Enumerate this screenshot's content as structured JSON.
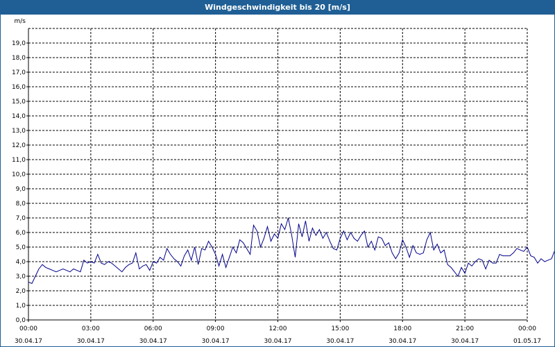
{
  "window": {
    "title": "Windgeschwindigkeit bis 20 [m/s]"
  },
  "colors": {
    "titlebar": "#1f5f95",
    "series": "#00008b",
    "grid": "#000000"
  },
  "chart_data": {
    "type": "line",
    "title": "Windgeschwindigkeit bis 20 [m/s]",
    "ylabel": "m/s",
    "ylim": [
      0,
      20
    ],
    "y_ticks": [
      "0,0",
      "1,0",
      "2,0",
      "3,0",
      "4,0",
      "5,0",
      "6,0",
      "7,0",
      "8,0",
      "9,0",
      "10,0",
      "11,0",
      "12,0",
      "13,0",
      "14,0",
      "15,0",
      "16,0",
      "17,0",
      "18,0",
      "19,0"
    ],
    "x_ticks": [
      {
        "time": "00:00",
        "date": "30.04.17"
      },
      {
        "time": "03:00",
        "date": "30.04.17"
      },
      {
        "time": "06:00",
        "date": "30.04.17"
      },
      {
        "time": "09:00",
        "date": "30.04.17"
      },
      {
        "time": "12:00",
        "date": "30.04.17"
      },
      {
        "time": "15:00",
        "date": "30.04.17"
      },
      {
        "time": "18:00",
        "date": "30.04.17"
      },
      {
        "time": "21:00",
        "date": "30.04.17"
      },
      {
        "time": "00:00",
        "date": "01.05.17"
      }
    ],
    "xlim": [
      "30.04.17 00:00",
      "01.05.17 00:00"
    ],
    "grid": true,
    "sample_interval_minutes": 10,
    "series": [
      {
        "values": [
          2.6,
          2.5,
          3.0,
          3.5,
          3.8,
          3.6,
          3.5,
          3.4,
          3.3,
          3.4,
          3.5,
          3.4,
          3.3,
          3.5,
          3.4,
          3.3,
          4.1,
          3.9,
          4.0,
          3.9,
          4.5,
          3.9,
          3.8,
          4.0,
          3.9,
          3.7,
          3.5,
          3.3,
          3.6,
          3.8,
          3.9,
          4.6,
          3.5,
          3.7,
          3.8,
          3.4,
          4.0,
          3.9,
          4.3,
          4.1,
          4.9,
          4.5,
          4.2,
          4.0,
          3.7,
          4.4,
          4.8,
          4.1,
          5.0,
          3.8,
          4.9,
          4.8,
          5.4,
          5.0,
          4.5,
          3.7,
          4.5,
          3.6,
          4.3,
          5.0,
          4.6,
          5.5,
          5.3,
          4.9,
          4.5,
          6.5,
          6.1,
          5.0,
          5.6,
          6.4,
          5.4,
          5.9,
          5.6,
          6.6,
          6.2,
          7.0,
          5.8,
          4.3,
          6.6,
          5.7,
          6.8,
          5.4,
          6.3,
          5.8,
          6.2,
          5.6,
          6.0,
          5.4,
          4.9,
          4.8,
          5.6,
          6.1,
          5.5,
          6.0,
          5.6,
          5.4,
          5.8,
          6.1,
          5.0,
          5.4,
          4.8,
          5.7,
          5.6,
          5.1,
          5.3,
          4.6,
          4.2,
          4.6,
          5.5,
          5.0,
          4.3,
          5.1,
          4.6,
          4.5,
          4.6,
          5.5,
          6.0,
          4.8,
          5.2,
          4.6,
          4.8,
          3.8,
          3.6,
          3.3,
          3.0,
          3.6,
          3.2,
          3.9,
          3.7,
          4.0,
          4.2,
          4.1,
          3.5,
          4.1,
          3.9,
          3.9,
          4.5,
          4.4,
          4.4,
          4.4,
          4.6,
          4.9,
          4.8,
          4.7,
          5.0,
          4.4,
          4.3,
          3.9,
          4.2,
          4.0,
          4.1,
          4.2,
          4.8
        ]
      }
    ]
  }
}
